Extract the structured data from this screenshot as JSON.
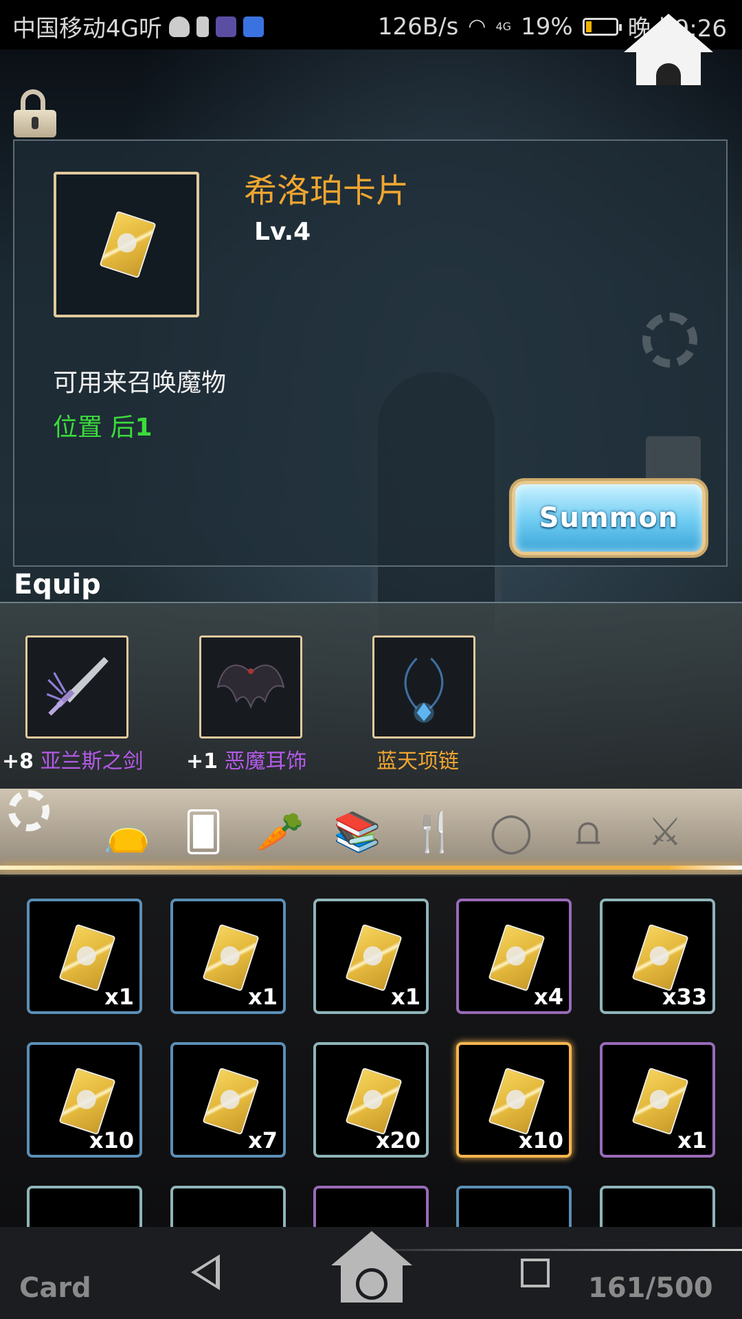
{
  "status_bar": {
    "carrier": "中国移动4G听",
    "network_speed": "126B/s",
    "signal": "4G",
    "battery": "19%",
    "battery_level": 0.19,
    "time": "晚上9:26"
  },
  "detail": {
    "name": "希洛珀卡片",
    "level": "Lv.4",
    "description": "可用来召唤魔物",
    "position_label": "位置 后",
    "position_value": "1",
    "summon_label": "Summon"
  },
  "equip": {
    "title": "Equip",
    "slots": [
      {
        "plus": "+8",
        "name": "亚兰斯之剑",
        "color": "#b45ae8",
        "icon": "sword-icon"
      },
      {
        "plus": "+1",
        "name": "恶魔耳饰",
        "color": "#b45ae8",
        "icon": "bat-wing-earring-icon"
      },
      {
        "plus": "",
        "name": "蓝天项链",
        "color": "#f0a530",
        "icon": "necklace-icon"
      }
    ]
  },
  "categories": [
    {
      "icon": "bag-icon",
      "glyph": "👝",
      "active": false
    },
    {
      "icon": "card-icon",
      "glyph": "🂠",
      "active": true
    },
    {
      "icon": "carrot-icon",
      "glyph": "🥕",
      "active": false
    },
    {
      "icon": "book-icon",
      "glyph": "📚",
      "active": false
    },
    {
      "icon": "fork-spoon-icon",
      "glyph": "🍴",
      "active": false
    },
    {
      "icon": "ring-icon",
      "glyph": "◯",
      "active": false
    },
    {
      "icon": "headband-icon",
      "glyph": "⩍",
      "active": false
    },
    {
      "icon": "sword-icon",
      "glyph": "⚔",
      "active": false
    }
  ],
  "inventory": [
    {
      "qty": "x1",
      "rarity": "blue"
    },
    {
      "qty": "x1",
      "rarity": "blue"
    },
    {
      "qty": "x1",
      "rarity": "teal"
    },
    {
      "qty": "x4",
      "rarity": "purple"
    },
    {
      "qty": "x33",
      "rarity": "teal"
    },
    {
      "qty": "x10",
      "rarity": "blue"
    },
    {
      "qty": "x7",
      "rarity": "blue"
    },
    {
      "qty": "x20",
      "rarity": "teal"
    },
    {
      "qty": "x10",
      "rarity": "selected"
    },
    {
      "qty": "x1",
      "rarity": "purple"
    }
  ],
  "inventory_partial_rarities": [
    "teal",
    "teal",
    "purple",
    "blue",
    "teal"
  ],
  "bottom": {
    "tab_label": "Card",
    "count": "161/500"
  }
}
